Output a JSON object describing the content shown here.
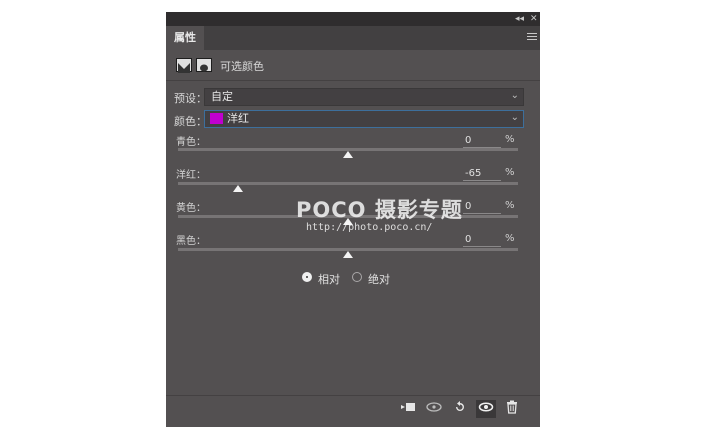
{
  "panel": {
    "topbar": {
      "collapse_glyph": "◂◂",
      "close_glyph": "✕"
    },
    "tab": {
      "label": "属性"
    },
    "header": {
      "icons": [
        "adjustment-layer-icon",
        "mask-icon"
      ],
      "title": "可选颜色"
    },
    "preset": {
      "label": "预设：",
      "value": "自定"
    },
    "colors": {
      "label": "颜色：",
      "value": "洋红",
      "swatch_color": "#c000d0"
    },
    "sliders": [
      {
        "label": "青色：",
        "value": "0",
        "unit": "%",
        "level": 0
      },
      {
        "label": "洋红：",
        "value": "-65",
        "unit": "%",
        "level": -65
      },
      {
        "label": "黄色：",
        "value": "0",
        "unit": "%",
        "level": 0
      },
      {
        "label": "黑色：",
        "value": "0",
        "unit": "%",
        "level": 0
      }
    ],
    "method": {
      "options": [
        {
          "label": "相对",
          "checked": true
        },
        {
          "label": "绝对",
          "checked": false
        }
      ]
    },
    "footer": {
      "buttons": [
        "clip-to-layer-icon",
        "view-previous-icon",
        "reset-icon",
        "visibility-eye-icon",
        "trash-icon"
      ]
    }
  },
  "watermark": {
    "text": "POCO 摄影专题",
    "url": "http://photo.poco.cn/"
  },
  "colors": {
    "panel_bg": "#535051",
    "focus_border": "#3d6f9c"
  }
}
